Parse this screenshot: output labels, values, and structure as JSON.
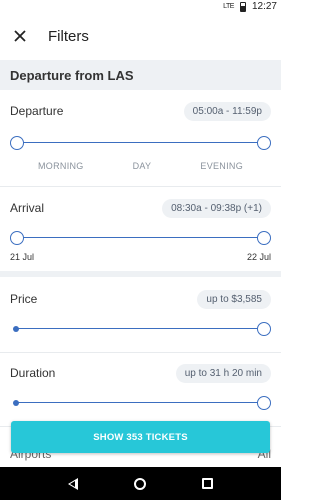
{
  "status_bar": {
    "signal": "LTE",
    "time": "12:27"
  },
  "app_bar": {
    "close_icon": "close-icon",
    "title": "Filters"
  },
  "section_header": "Departure from LAS",
  "departure": {
    "label": "Departure",
    "range": "05:00a - 11:59p",
    "ticks": [
      "MORNING",
      "DAY",
      "EVENING"
    ]
  },
  "arrival": {
    "label": "Arrival",
    "range": "08:30a - 09:38p (+1)",
    "start_date": "21 Jul",
    "end_date": "22 Jul"
  },
  "price": {
    "label": "Price",
    "range": "up to $3,585"
  },
  "duration": {
    "label": "Duration",
    "range": "up to 31 h 20 min"
  },
  "airports": {
    "label": "Airports",
    "value": "All"
  },
  "show_button": "SHOW 353 TICKETS",
  "colors": {
    "accent": "#3b6ec0",
    "button": "#27c7d8",
    "section_bg": "#eef1f4"
  }
}
